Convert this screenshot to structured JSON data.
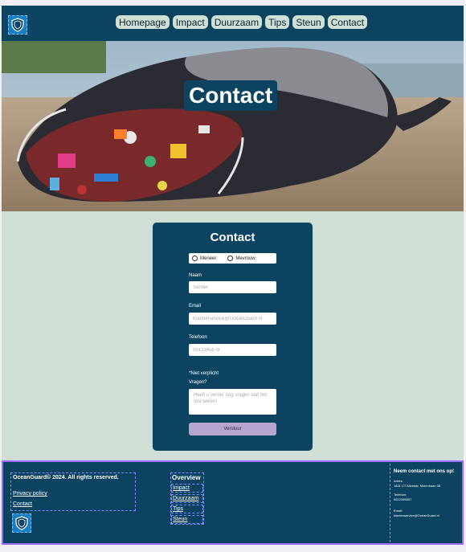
{
  "nav": {
    "items": [
      "Homepage",
      "Impact",
      "Duurzaam",
      "Tips",
      "Steun",
      "Contact"
    ]
  },
  "hero": {
    "title": "Contact"
  },
  "form": {
    "title": "Contact",
    "gender_options": [
      "Meneer",
      "Mevrouw"
    ],
    "name_label": "Naam",
    "name_placeholder": "Sander",
    "email_label": "Email",
    "email_placeholder": "Klantenservice@OceanGuard.nl",
    "phone_label": "Telefoon",
    "phone_placeholder": "0612345678",
    "optional_note": "*Niet verplicht",
    "questions_label": "Vragen?",
    "questions_placeholder": "Heeft u verder nog vragen laat het ons weten!",
    "submit_label": "Verstuur"
  },
  "footer": {
    "copyright": "OceanGuard© 2024. All rights reserved.",
    "privacy_label": "Privacy policy",
    "contact_label": "Contact",
    "overview_heading": "Overview",
    "overview_items": [
      "Impact",
      "Duurzaam",
      "Tips",
      "Steun"
    ],
    "contact_heading": "Neem contact met ons op!",
    "address_label": "Adres:",
    "address_value": "1821 CT Alkmaar, Molenbaan 38",
    "phone_label": "Telefoon:",
    "phone_value": "0612345657",
    "email_label": "Email:",
    "email_value": "klantenservice@OceanGuard.nl"
  },
  "colors": {
    "primary": "#0b4361",
    "background": "#cfdfd5",
    "button": "#b6a6cf"
  }
}
